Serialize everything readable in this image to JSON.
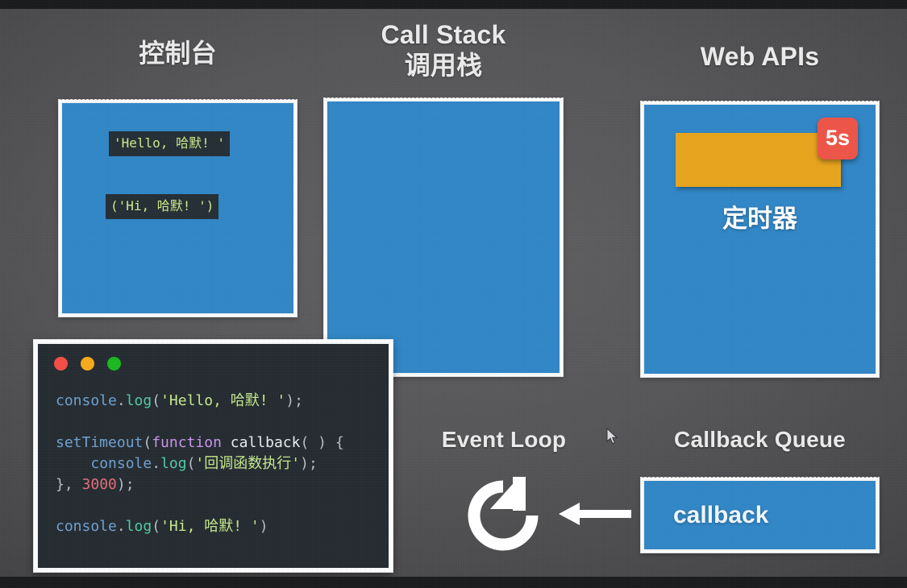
{
  "slide": {
    "title_console": "控制台",
    "title_callstack_en": "Call Stack",
    "title_callstack_zh": "调用栈",
    "title_webapis": "Web APIs",
    "title_eventloop": "Event Loop",
    "title_callbackqueue": "Callback Queue"
  },
  "console_panel": {
    "lines": [
      "'Hello, 哈默! '",
      "('Hi, 哈默! ')"
    ]
  },
  "call_stack_panel": {
    "frames": []
  },
  "web_apis_panel": {
    "timer_label": "定时器",
    "timer_badge": "5s"
  },
  "callback_queue_panel": {
    "item_label": "callback"
  },
  "editor": {
    "window_dots": [
      "close-red",
      "minimize-yellow",
      "zoom-green"
    ],
    "code_lines": [
      {
        "tokens": [
          {
            "t": "console",
            "c": "tok-obj"
          },
          {
            "t": ".",
            "c": "tok-punc"
          },
          {
            "t": "log",
            "c": "tok-fn"
          },
          {
            "t": "(",
            "c": "tok-punc"
          },
          {
            "t": "'Hello, 哈默! '",
            "c": "tok-str"
          },
          {
            "t": ");",
            "c": "tok-punc"
          }
        ]
      },
      {
        "tokens": []
      },
      {
        "tokens": [
          {
            "t": "setTimeout",
            "c": "tok-obj"
          },
          {
            "t": "(",
            "c": "tok-punc"
          },
          {
            "t": "function",
            "c": "tok-kw"
          },
          {
            "t": " ",
            "c": "tok-punc"
          },
          {
            "t": "callback",
            "c": "tok-name"
          },
          {
            "t": "( ) {",
            "c": "tok-punc"
          }
        ]
      },
      {
        "tokens": [
          {
            "t": "    ",
            "c": "tok-punc"
          },
          {
            "t": "console",
            "c": "tok-obj"
          },
          {
            "t": ".",
            "c": "tok-punc"
          },
          {
            "t": "log",
            "c": "tok-fn"
          },
          {
            "t": "(",
            "c": "tok-punc"
          },
          {
            "t": "'回调函数执行'",
            "c": "tok-str"
          },
          {
            "t": ");",
            "c": "tok-punc"
          }
        ]
      },
      {
        "tokens": [
          {
            "t": "}, ",
            "c": "tok-punc"
          },
          {
            "t": "3000",
            "c": "tok-num"
          },
          {
            "t": ");",
            "c": "tok-punc"
          }
        ]
      },
      {
        "tokens": []
      },
      {
        "tokens": [
          {
            "t": "console",
            "c": "tok-obj"
          },
          {
            "t": ".",
            "c": "tok-punc"
          },
          {
            "t": "log",
            "c": "tok-fn"
          },
          {
            "t": "(",
            "c": "tok-punc"
          },
          {
            "t": "'Hi, 哈默! '",
            "c": "tok-str"
          },
          {
            "t": ")",
            "c": "tok-punc"
          }
        ]
      }
    ]
  },
  "colors": {
    "background": "#555557",
    "panel_blue": "#2e84c4",
    "chalk_border": "#f2f4f5",
    "timer_orange": "#e5a21a",
    "badge_red": "#ec5245",
    "editor_bg": "#22292e",
    "console_row_bg": "#222c33",
    "console_text_green": "#c9e98a",
    "letterbox": "#17181a"
  }
}
